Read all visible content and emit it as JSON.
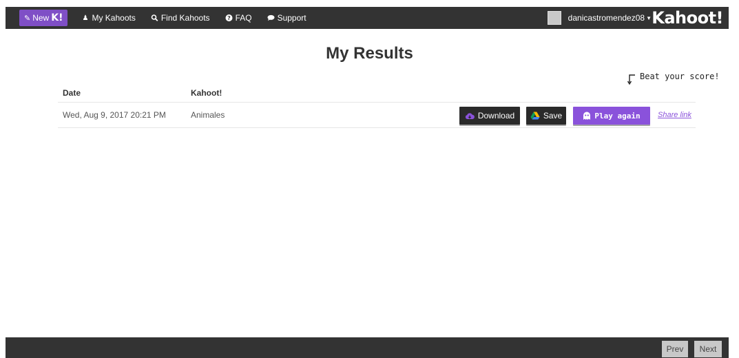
{
  "nav": {
    "new_label": "New",
    "new_k": "K!",
    "links": [
      {
        "label": "My Kahoots",
        "icon": "user-icon"
      },
      {
        "label": "Find Kahoots",
        "icon": "search-icon"
      },
      {
        "label": "FAQ",
        "icon": "question-icon"
      },
      {
        "label": "Support",
        "icon": "chat-bubble-icon"
      }
    ],
    "username": "danicastromendez08",
    "logo": "Kahoot!"
  },
  "page": {
    "title": "My Results",
    "beat_score": "Beat your score!"
  },
  "table": {
    "headers": {
      "date": "Date",
      "kahoot": "Kahoot!"
    },
    "rows": [
      {
        "date": "Wed, Aug 9, 2017 20:21 PM",
        "kahoot": "Animales",
        "download_label": "Download",
        "save_label": "Save",
        "play_label": "Play again",
        "share_label": "Share link"
      }
    ]
  },
  "pagination": {
    "prev": "Prev",
    "next": "Next"
  },
  "colors": {
    "accent": "#8a52db",
    "nav_bg": "#333333"
  }
}
